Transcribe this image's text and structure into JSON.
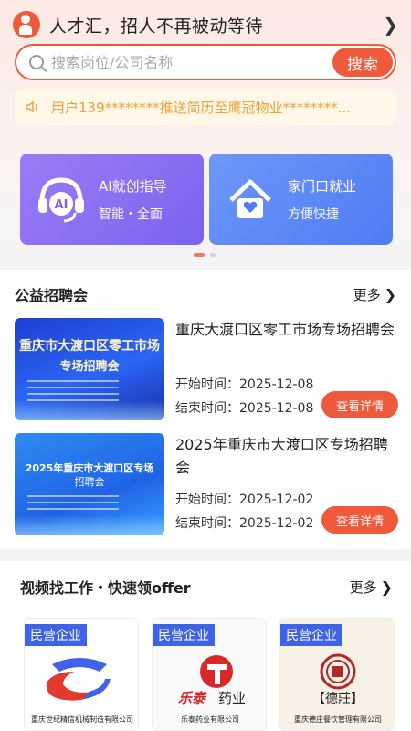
{
  "header": {
    "slogan": "人才汇，招人不再被动等待"
  },
  "search": {
    "placeholder": "搜索岗位/公司名称",
    "button_label": "搜索"
  },
  "notice": {
    "text": "用户139********推送简历至鹰冠物业********..."
  },
  "quick_cards": [
    {
      "title": "AI就创指导",
      "subtitle": "智能・全面",
      "icon": "ai-headset-icon",
      "color": "#8b6ff2"
    },
    {
      "title": "家门口就业",
      "subtitle": "方便快捷",
      "icon": "home-icon",
      "color": "#5a86f5"
    }
  ],
  "job_fairs": {
    "title": "公益招聘会",
    "more_label": "更多",
    "items": [
      {
        "title": "重庆大渡口区零工市场专场招聘会",
        "image_line1": "重庆市大渡口区零工市场",
        "image_line2": "专场招聘会",
        "start_label": "开始时间：",
        "start": "2025-12-08",
        "end_label": "结束时间：",
        "end": "2025-12-08",
        "button": "查看详情"
      },
      {
        "title": "2025年重庆市大渡口区专场招聘会",
        "image_line1": "2025年重庆市大渡口区专场",
        "image_line2": "招聘会",
        "start_label": "开始时间：",
        "start": "2025-12-02",
        "end_label": "结束时间：",
        "end": "2025-12-02",
        "button": "查看详情"
      }
    ]
  },
  "video_jobs": {
    "title": "视频找工作・快速领offer",
    "more_label": "更多",
    "items": [
      {
        "badge": "民营企业",
        "company": "重庆世纪精信机械制造有限公司"
      },
      {
        "badge": "民营企业",
        "company": "乐泰药业有限公司",
        "logo_text": "乐泰 药业"
      },
      {
        "badge": "民营企业",
        "company": "重庆德庄餐饮管理有限公司",
        "logo_text": "德莊"
      }
    ]
  },
  "colors": {
    "accent": "#ef5a3c",
    "badge": "#3f62e8",
    "notice_text": "#e8a33a"
  }
}
